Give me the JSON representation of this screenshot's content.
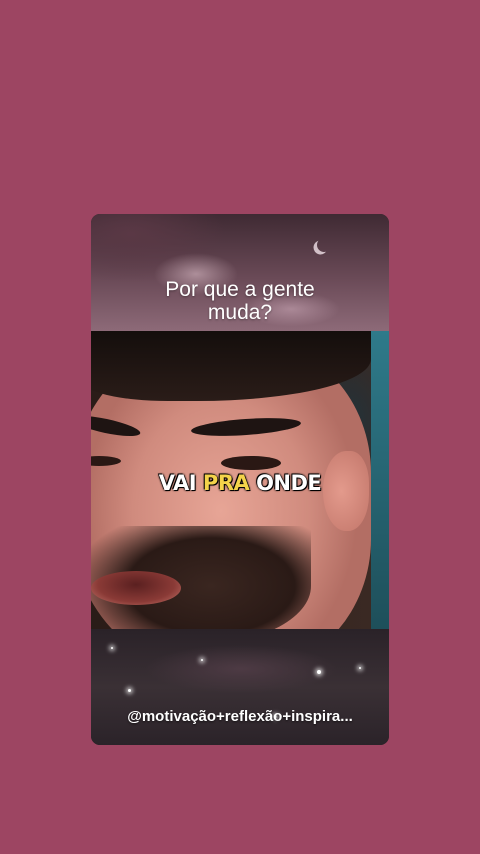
{
  "story": {
    "headline_line1": "Por que a gente",
    "headline_line2": "muda?",
    "caption_word1": "VAI",
    "caption_word2": "PRA",
    "caption_word3": "ONDE",
    "handle": "@motivação+reflexão+inspira..."
  },
  "colors": {
    "background": "#9d4562",
    "caption_highlight": "#f4d34a"
  }
}
